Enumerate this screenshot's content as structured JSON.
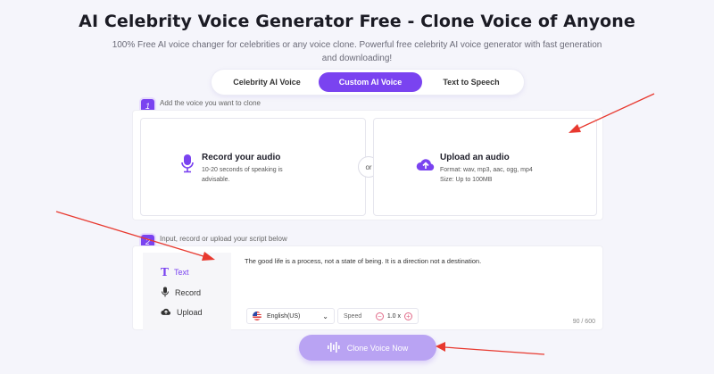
{
  "header": {
    "title": "AI Celebrity Voice Generator Free - Clone Voice of Anyone",
    "subtitle": "100% Free AI voice changer for celebrities or any voice clone. Powerful free celebrity AI voice generator with fast generation and downloading!"
  },
  "tabs": [
    {
      "label": "Celebrity AI Voice",
      "active": false
    },
    {
      "label": "Custom AI Voice",
      "active": true
    },
    {
      "label": "Text to Speech",
      "active": false
    }
  ],
  "step1": {
    "number": "1",
    "label": "Add the voice you want to clone",
    "record": {
      "title": "Record your audio",
      "desc_line1": "10-20 seconds of speaking is",
      "desc_line2": "advisable.",
      "icon": "microphone-icon"
    },
    "or_label": "or",
    "upload": {
      "title": "Upload an audio",
      "format": "Format: wav, mp3, aac, ogg, mp4",
      "size": "Size: Up to 100MB",
      "icon": "cloud-upload-icon"
    }
  },
  "step2": {
    "number": "2",
    "label": "Input, record or upload your script below",
    "menu": [
      {
        "label": "Text",
        "icon": "text-icon",
        "active": true
      },
      {
        "label": "Record",
        "icon": "microphone-icon",
        "active": false
      },
      {
        "label": "Upload",
        "icon": "cloud-upload-icon",
        "active": false
      }
    ],
    "script_text": "The good life is a process, not a state of being. It is a direction not a destination.",
    "language": "English(US)",
    "speed_label": "Speed",
    "speed_value": "1.0 x",
    "counter": "90 / 600"
  },
  "action": {
    "clone_label": "Clone Voice Now"
  },
  "colors": {
    "accent": "#7a43f0",
    "button_disabled": "#b9a3f3",
    "arrow": "#e8392f"
  }
}
